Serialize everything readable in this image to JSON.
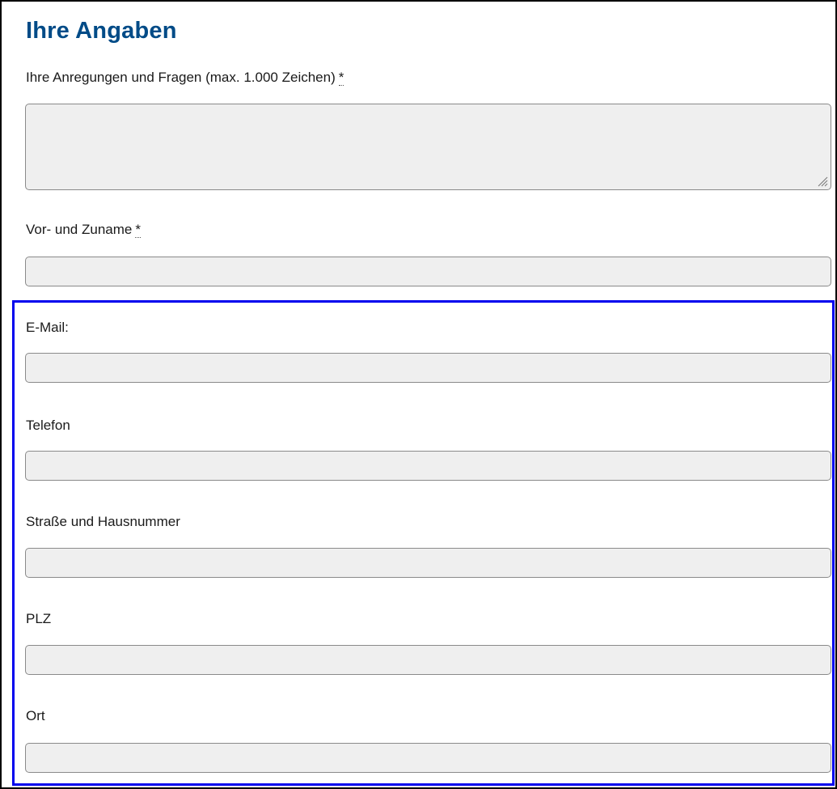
{
  "form": {
    "title": "Ihre Angaben",
    "required_marker": "*",
    "fields": [
      {
        "label": "Ihre Anregungen und Fragen (max. 1.000 Zeichen)",
        "required": true,
        "type": "textarea",
        "value": ""
      },
      {
        "label": "Vor- und Zuname",
        "required": true,
        "type": "text",
        "value": ""
      },
      {
        "label": "E-Mail:",
        "required": false,
        "type": "text",
        "value": ""
      },
      {
        "label": "Telefon",
        "required": false,
        "type": "text",
        "value": ""
      },
      {
        "label": "Straße und Hausnummer",
        "required": false,
        "type": "text",
        "value": ""
      },
      {
        "label": "PLZ",
        "required": false,
        "type": "text",
        "value": ""
      },
      {
        "label": "Ort",
        "required": false,
        "type": "text",
        "value": ""
      }
    ]
  },
  "colors": {
    "heading": "#004b87",
    "highlight_border": "#0000ee",
    "field_background": "#efefef",
    "field_border": "#8a8a8a"
  },
  "icons": {
    "textarea_resize": "resize-grip-icon"
  }
}
